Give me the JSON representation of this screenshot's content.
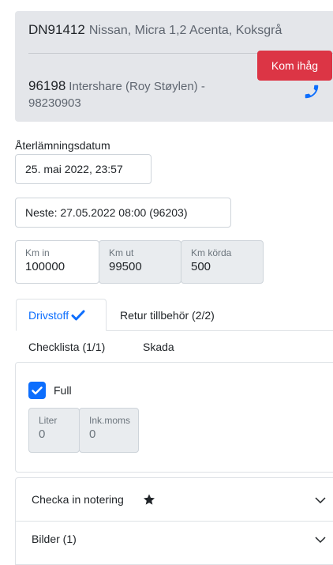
{
  "vehicle": {
    "plate": "DN91412",
    "model": "Nissan, Micra 1,2 Acenta, Koksgrå",
    "customer_id": "96198",
    "customer_name": "Intershare (Roy Støylen) -",
    "phone": "98230903",
    "remind_label": "Kom ihåg"
  },
  "return_date": {
    "label": "Återlämningsdatum",
    "value": "25. mai 2022, 23:57"
  },
  "next_booking": "Neste: 27.05.2022 08:00 (96203)",
  "km": {
    "in": {
      "label": "Km in",
      "value": "100000"
    },
    "out": {
      "label": "Km ut",
      "value": "99500"
    },
    "driven": {
      "label": "Km körda",
      "value": "500"
    }
  },
  "tabs": {
    "fuel": "Drivstoff",
    "accessories": "Retur tillbehör (2/2)",
    "checklist": "Checklista (1/1)",
    "damage": "Skada"
  },
  "fuel_panel": {
    "full_label": "Full",
    "liter": {
      "label": "Liter",
      "value": "0"
    },
    "incl_vat": {
      "label": "Ink.moms",
      "value": "0"
    }
  },
  "accordion": {
    "checkin_note": "Checka in notering",
    "photos": "Bilder (1)"
  },
  "colors": {
    "primary": "#0d6efd",
    "danger": "#dc3545",
    "card_bg": "#e4e6ea"
  }
}
